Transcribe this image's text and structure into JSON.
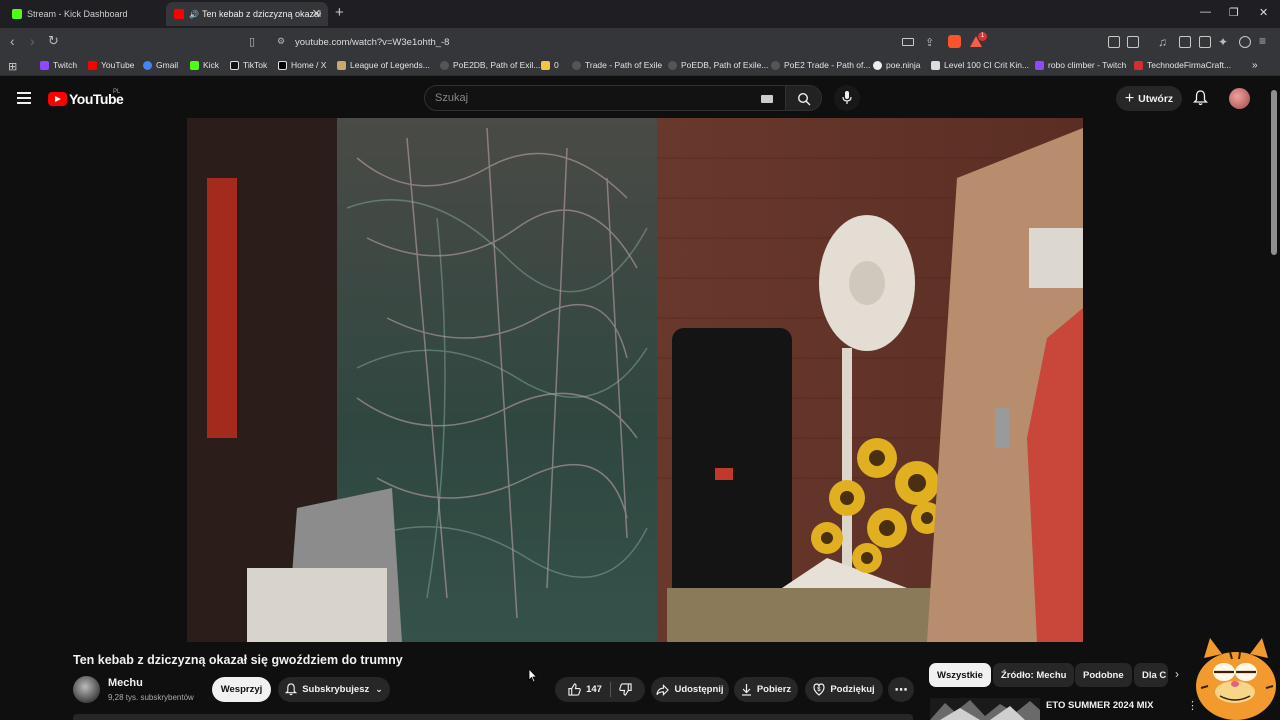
{
  "browser": {
    "tabs": [
      {
        "title": "Stream - Kick Dashboard",
        "favicon": "kick-icon",
        "active": false
      },
      {
        "title": "Ten kebab z dziczyzną okazał",
        "favicon": "youtube-icon",
        "active": true
      }
    ],
    "url": "youtube.com/watch?v=W3e1ohth_-8",
    "bookmarks": [
      {
        "label": "Twitch",
        "icon": "twitch-icon",
        "color": "#9146ff"
      },
      {
        "label": "YouTube",
        "icon": "youtube-icon",
        "color": "#ff0000"
      },
      {
        "label": "Gmail",
        "icon": "google-icon",
        "color": "#4285f4"
      },
      {
        "label": "Kick",
        "icon": "kick-icon",
        "color": "#53fc18"
      },
      {
        "label": "TikTok",
        "icon": "tiktok-icon",
        "color": "#ffffff"
      },
      {
        "label": "Home / X",
        "icon": "x-icon",
        "color": "#ffffff"
      },
      {
        "label": "League of Legends...",
        "icon": "lol-icon",
        "color": "#c8aa6e"
      },
      {
        "label": "PoE2DB, Path of Exil...",
        "icon": "poe-icon",
        "color": "#888888"
      },
      {
        "label": "0",
        "icon": "folder-icon",
        "color": "#f4c542"
      },
      {
        "label": "Trade - Path of Exile",
        "icon": "poe-icon",
        "color": "#888888"
      },
      {
        "label": "PoEDB, Path of Exile...",
        "icon": "poe-icon",
        "color": "#888888"
      },
      {
        "label": "PoE2 Trade - Path of...",
        "icon": "poe-icon",
        "color": "#888888"
      },
      {
        "label": "poe.ninja",
        "icon": "ninja-icon",
        "color": "#ffffff"
      },
      {
        "label": "Level 100 CI Crit Kin...",
        "icon": "page-icon",
        "color": "#dddddd"
      },
      {
        "label": "robo climber - Twitch",
        "icon": "twitch-icon",
        "color": "#9146ff"
      },
      {
        "label": "TechnodeFirmaCraft...",
        "icon": "tfc-icon",
        "color": "#d03030"
      }
    ],
    "extension_badge": "1"
  },
  "youtube": {
    "logo_text": "YouTube",
    "country_code": "PL",
    "search_placeholder": "Szukaj",
    "create_label": "Utwórz",
    "accent_color": "#ff0000"
  },
  "video": {
    "title": "Ten kebab z dziczyzną okazał się gwoździem do trumny",
    "channel_name": "Mechu",
    "subscribers": "9,28 tys. subskrybentów",
    "support_label": "Wesprzyj",
    "subscribed_label": "Subskrybujesz",
    "like_count": "147",
    "share_label": "Udostępnij",
    "download_label": "Pobierz",
    "thanks_label": "Podziękuj"
  },
  "sidebar": {
    "chips": [
      "Wszystkie",
      "Źródło: Mechu",
      "Podobne",
      "Dla C"
    ],
    "recommendation_title": "ETO SUMMER 2024 MIX"
  }
}
